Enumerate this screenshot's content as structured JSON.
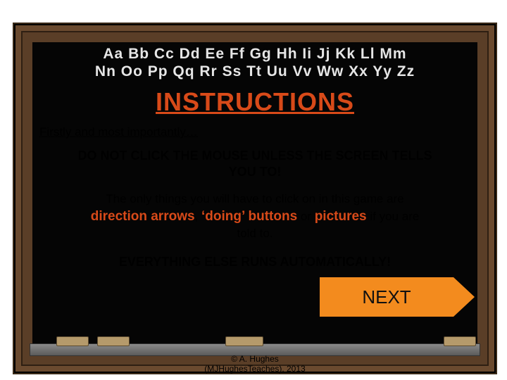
{
  "alphabet": {
    "row1": "Aa Bb Cc Dd Ee Ff Gg Hh Ii Jj Kk Ll Mm",
    "row2": "Nn Oo Pp Qq Rr Ss Tt Uu Vv Ww Xx Yy Zz"
  },
  "title": "INSTRUCTIONS",
  "lead": "Firstly and most importantly…",
  "rule1_line1": "DO NOT CLICK THE MOUSE UNLESS THE SCREEN TELLS",
  "rule1_line2": "YOU TO!",
  "rule2": {
    "pre": "The only things you will have to click on in this game are",
    "arrows": "direction arrows",
    "sep1": ", ",
    "doing": "‘doing’ buttons",
    "mid": " or ",
    "pictures": "pictures",
    "post_line1": " if you are",
    "post_line2": "told to."
  },
  "rule3": "EVERYTHING ELSE RUNS AUTOMATICALLY!",
  "next": "NEXT",
  "credit_line1": "© A. Hughes",
  "credit_line2": "(MJHughesTeaches), 2013"
}
